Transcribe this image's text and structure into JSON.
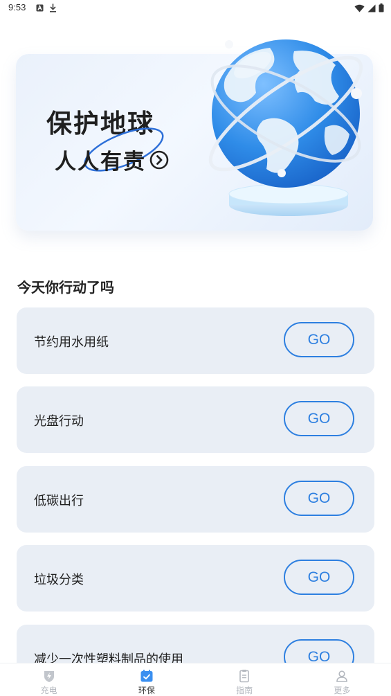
{
  "status_bar": {
    "time": "9:53",
    "left_icons": [
      "a-box-icon",
      "download-icon"
    ],
    "right_icons": [
      "wifi-icon",
      "signal-icon",
      "battery-icon"
    ]
  },
  "banner": {
    "slogan_line1": "保护地球",
    "slogan_line2": "人人有责",
    "arrow_icon": "chevron-right-circle-icon",
    "illustration": "globe-illustration"
  },
  "section": {
    "title": "今天你行动了吗"
  },
  "tasks": [
    {
      "label": "节约用水用纸",
      "button": "GO"
    },
    {
      "label": "光盘行动",
      "button": "GO"
    },
    {
      "label": "低碳出行",
      "button": "GO"
    },
    {
      "label": "垃圾分类",
      "button": "GO"
    },
    {
      "label": "减少一次性塑料制品的使用",
      "button": "GO"
    }
  ],
  "bottom_nav": {
    "items": [
      {
        "label": "充电",
        "icon": "charge-shield-icon",
        "active": false
      },
      {
        "label": "环保",
        "icon": "calendar-check-icon",
        "active": true
      },
      {
        "label": "指南",
        "icon": "clipboard-icon",
        "active": false
      },
      {
        "label": "更多",
        "icon": "user-icon",
        "active": false
      }
    ]
  },
  "colors": {
    "accent": "#2d7fe0",
    "card_bg": "#e9eef5",
    "nav_active_icon": "#3a8ff0",
    "nav_inactive": "#b4b8bf"
  }
}
